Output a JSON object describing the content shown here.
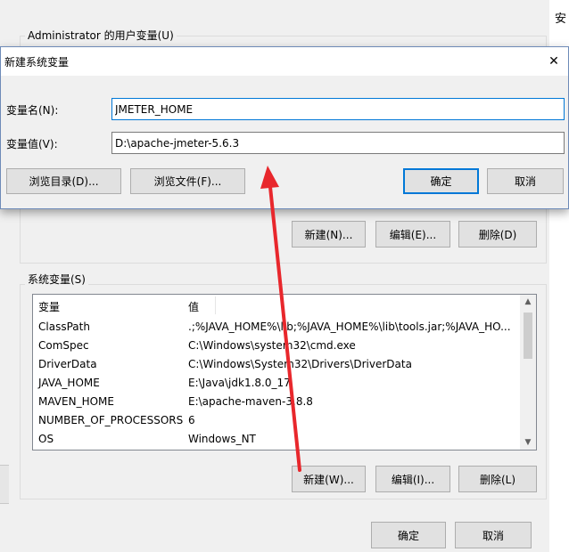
{
  "background_window": {
    "partial_title_char": "安",
    "user_vars_title": "Administrator 的用户变量(U)",
    "user_buttons": {
      "new": "新建(N)...",
      "edit": "编辑(E)...",
      "delete": "删除(D)"
    },
    "system_vars_title": "系统变量(S)",
    "table": {
      "col_variable": "变量",
      "col_value": "值",
      "rows": [
        {
          "name": "ClassPath",
          "value": ".;%JAVA_HOME%\\lib;%JAVA_HOME%\\lib\\tools.jar;%JAVA_HO..."
        },
        {
          "name": "ComSpec",
          "value": "C:\\Windows\\system32\\cmd.exe"
        },
        {
          "name": "DriverData",
          "value": "C:\\Windows\\System32\\Drivers\\DriverData"
        },
        {
          "name": "JAVA_HOME",
          "value": "E:\\Java\\jdk1.8.0_17"
        },
        {
          "name": "MAVEN_HOME",
          "value": "E:\\apache-maven-3.8.8"
        },
        {
          "name": "NUMBER_OF_PROCESSORS",
          "value": "6"
        },
        {
          "name": "OS",
          "value": "Windows_NT"
        }
      ]
    },
    "system_buttons": {
      "new": "新建(W)...",
      "edit": "编辑(I)...",
      "delete": "删除(L)"
    },
    "footer_buttons": {
      "ok": "确定",
      "cancel": "取消"
    }
  },
  "dialog": {
    "title": "新建系统变量",
    "name_label": "变量名(N):",
    "name_value": "JMETER_HOME",
    "value_label": "变量值(V):",
    "value_value": "D:\\apache-jmeter-5.6.3",
    "browse_dir": "浏览目录(D)...",
    "browse_file": "浏览文件(F)...",
    "ok": "确定",
    "cancel": "取消"
  },
  "colors": {
    "annotation_arrow": "#e8272c",
    "focus_accent": "#0078d7"
  },
  "icons": {
    "close": "close-icon",
    "scroll_up": "chevron-up-icon",
    "scroll_down": "chevron-down-icon"
  }
}
